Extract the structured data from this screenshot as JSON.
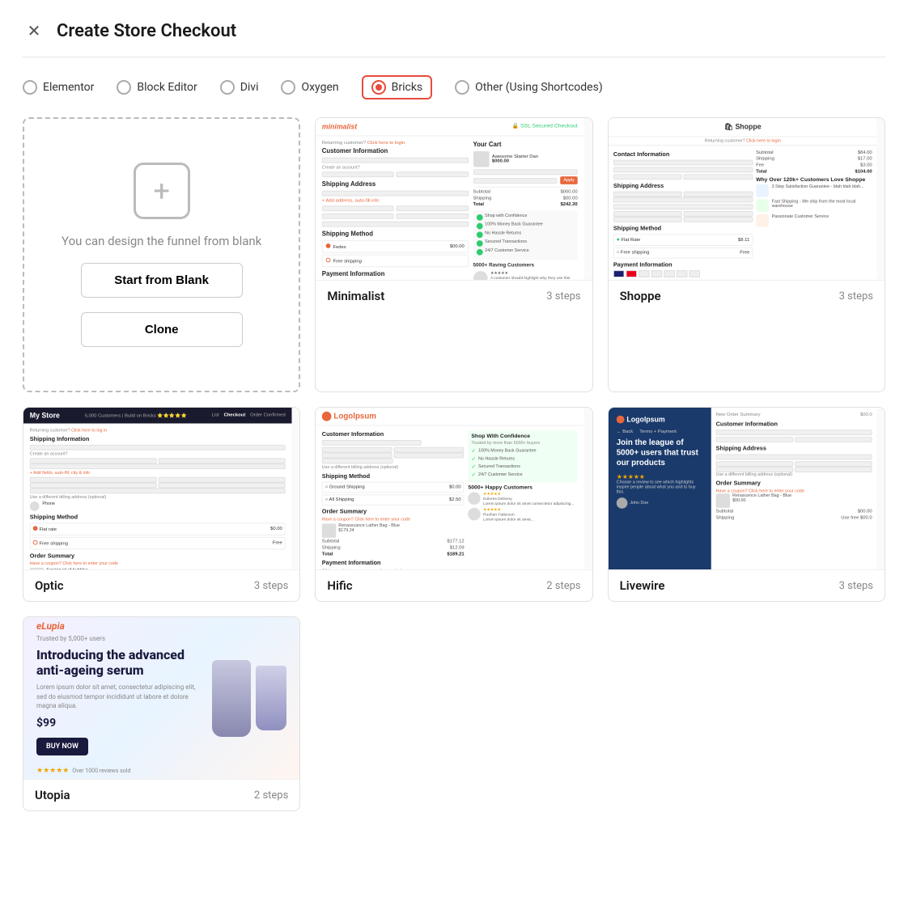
{
  "modal": {
    "title": "Create Store Checkout",
    "close_label": "✕"
  },
  "radio_group": {
    "options": [
      {
        "id": "elementor",
        "label": "Elementor",
        "selected": false
      },
      {
        "id": "block-editor",
        "label": "Block Editor",
        "selected": false
      },
      {
        "id": "divi",
        "label": "Divi",
        "selected": false
      },
      {
        "id": "oxygen",
        "label": "Oxygen",
        "selected": false
      },
      {
        "id": "bricks",
        "label": "Bricks",
        "selected": true
      },
      {
        "id": "other",
        "label": "Other (Using Shortcodes)",
        "selected": false
      }
    ]
  },
  "blank_card": {
    "text": "You can design the funnel from blank",
    "start_label": "Start from Blank",
    "clone_label": "Clone"
  },
  "templates": [
    {
      "id": "minimalist",
      "name": "Minimalist",
      "steps": "3 steps"
    },
    {
      "id": "shoppe",
      "name": "Shoppe",
      "steps": "3 steps"
    },
    {
      "id": "optic",
      "name": "Optic",
      "steps": "3 steps"
    },
    {
      "id": "hific",
      "name": "Hific",
      "steps": "2 steps"
    },
    {
      "id": "livewire",
      "name": "Livewire",
      "steps": "3 steps"
    },
    {
      "id": "utopia",
      "name": "Utopia",
      "steps": "2 steps"
    }
  ],
  "colors": {
    "accent": "#e74c3c",
    "orange": "#e8673c",
    "green": "#2ecc71",
    "dark_blue": "#1a3a6b",
    "gold": "#f0a500"
  }
}
